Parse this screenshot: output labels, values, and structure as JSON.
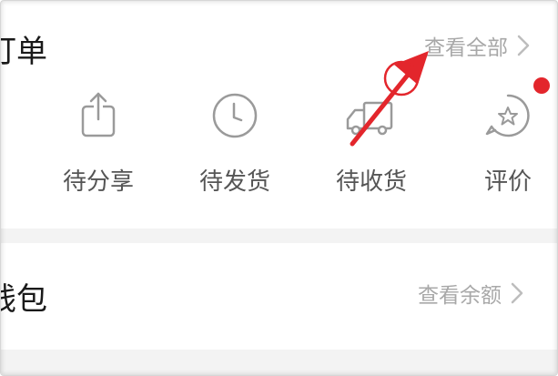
{
  "orders": {
    "title": "订单",
    "view_all": "查看全部",
    "items": [
      {
        "label": "待分享",
        "icon": "share-icon"
      },
      {
        "label": "待发货",
        "icon": "clock-icon"
      },
      {
        "label": "待收货",
        "icon": "truck-icon"
      },
      {
        "label": "评价",
        "icon": "review-icon"
      }
    ]
  },
  "wallet": {
    "title": "钱包",
    "view_balance": "查看余额"
  },
  "colors": {
    "accent_red": "#e3262c",
    "icon_gray": "#9a9a9a",
    "link_gray": "#a8a8a8",
    "divider": "#f3f3f3"
  }
}
